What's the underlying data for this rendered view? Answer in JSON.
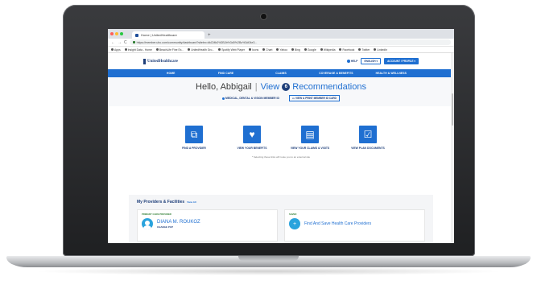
{
  "browser": {
    "tab_title": "Home | UnitedHealthcare",
    "new_tab": "+",
    "nav_icons": [
      "←",
      "→",
      "C"
    ],
    "url": "https://member.uhc.com/community/dashboard?sitebn=#kCMk0%2BJb%3d0%2Bz%3d04e3...",
    "bookmarks": [
      "Apps",
      "Insight Data - Home",
      "BeachLife Fine Ex...",
      "UnitedHealth Gro...",
      "Spotify Web Player",
      "Icons",
      "Chart",
      "Yahoo",
      "Bing",
      "Google",
      "Wikipedia",
      "Facebook",
      "Twitter",
      "LinkedIn"
    ],
    "dot_colors": [
      "#ff5f57",
      "#febc2e",
      "#28c840"
    ]
  },
  "header": {
    "logo": "UnitedHealthcare",
    "help": "HELP",
    "language": "ENGLISH ▾",
    "account": "ACCOUNT / PROFILE ▾"
  },
  "nav": {
    "items": [
      "HOME",
      "FIND CARE",
      "CLAIMS",
      "COVERAGE & BENEFITS",
      "HEALTH & WELLNESS"
    ]
  },
  "hero": {
    "greeting": "Hello, Abbigail",
    "separator": "|",
    "view": "View",
    "count": "6",
    "recommendations": "Recommendations",
    "link_ids": "MEDICAL, DENTAL & VISION MEMBER ID",
    "link_print": "VIEW & PRINT MEMBER ID CARD"
  },
  "actions": [
    {
      "label": "FIND A PROVIDER",
      "icon": "⧉"
    },
    {
      "label": "VIEW YOUR BENEFITS",
      "icon": "♥"
    },
    {
      "label": "VIEW YOUR CLAIMS & VISITS",
      "icon": "▤"
    },
    {
      "label": "VIEW PLAN DOCUMENTS",
      "icon": "☑"
    }
  ],
  "note": "* Selecting these links will route you to an external site",
  "providers": {
    "title": "My Providers & Facilities",
    "view_all": "View All",
    "pcp_label": "PRIMARY CARE PROVIDER",
    "pcp_name": "DIANA M. ROUKOZ",
    "pcp_sub": "CHANGE PCP",
    "saved_label": "SAVED",
    "saved_text": "Find And Save Health Care Providers",
    "save_icon": "+"
  },
  "colors": {
    "primary": "#1f6fd1",
    "navy": "#1f3f7a",
    "teal": "#29a3dd"
  }
}
